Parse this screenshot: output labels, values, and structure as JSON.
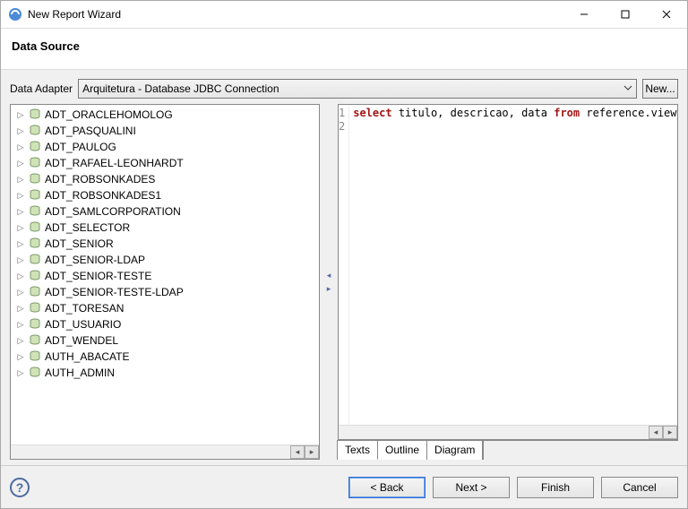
{
  "window": {
    "title": "New Report Wizard"
  },
  "header": {
    "title": "Data Source"
  },
  "adapter": {
    "label": "Data Adapter",
    "value": "Arquitetura - Database JDBC Connection",
    "new_button": "New..."
  },
  "tree": {
    "items": [
      "ADT_ORACLEHOMOLOG",
      "ADT_PASQUALINI",
      "ADT_PAULOG",
      "ADT_RAFAEL-LEONHARDT",
      "ADT_ROBSONKADES",
      "ADT_ROBSONKADES1",
      "ADT_SAMLCORPORATION",
      "ADT_SELECTOR",
      "ADT_SENIOR",
      "ADT_SENIOR-LDAP",
      "ADT_SENIOR-TESTE",
      "ADT_SENIOR-TESTE-LDAP",
      "ADT_TORESAN",
      "ADT_USUARIO",
      "ADT_WENDEL",
      "AUTH_ABACATE",
      "AUTH_ADMIN"
    ]
  },
  "editor": {
    "lines": [
      "1",
      "2"
    ],
    "tokens": [
      {
        "t": "select",
        "k": true
      },
      {
        "t": " titulo, descricao, data ",
        "k": false
      },
      {
        "t": "from",
        "k": true
      },
      {
        "t": " reference.view_tarefa",
        "k": false
      }
    ],
    "tabs": [
      "Texts",
      "Outline",
      "Diagram"
    ]
  },
  "footer": {
    "back": "< Back",
    "next": "Next >",
    "finish": "Finish",
    "cancel": "Cancel"
  }
}
